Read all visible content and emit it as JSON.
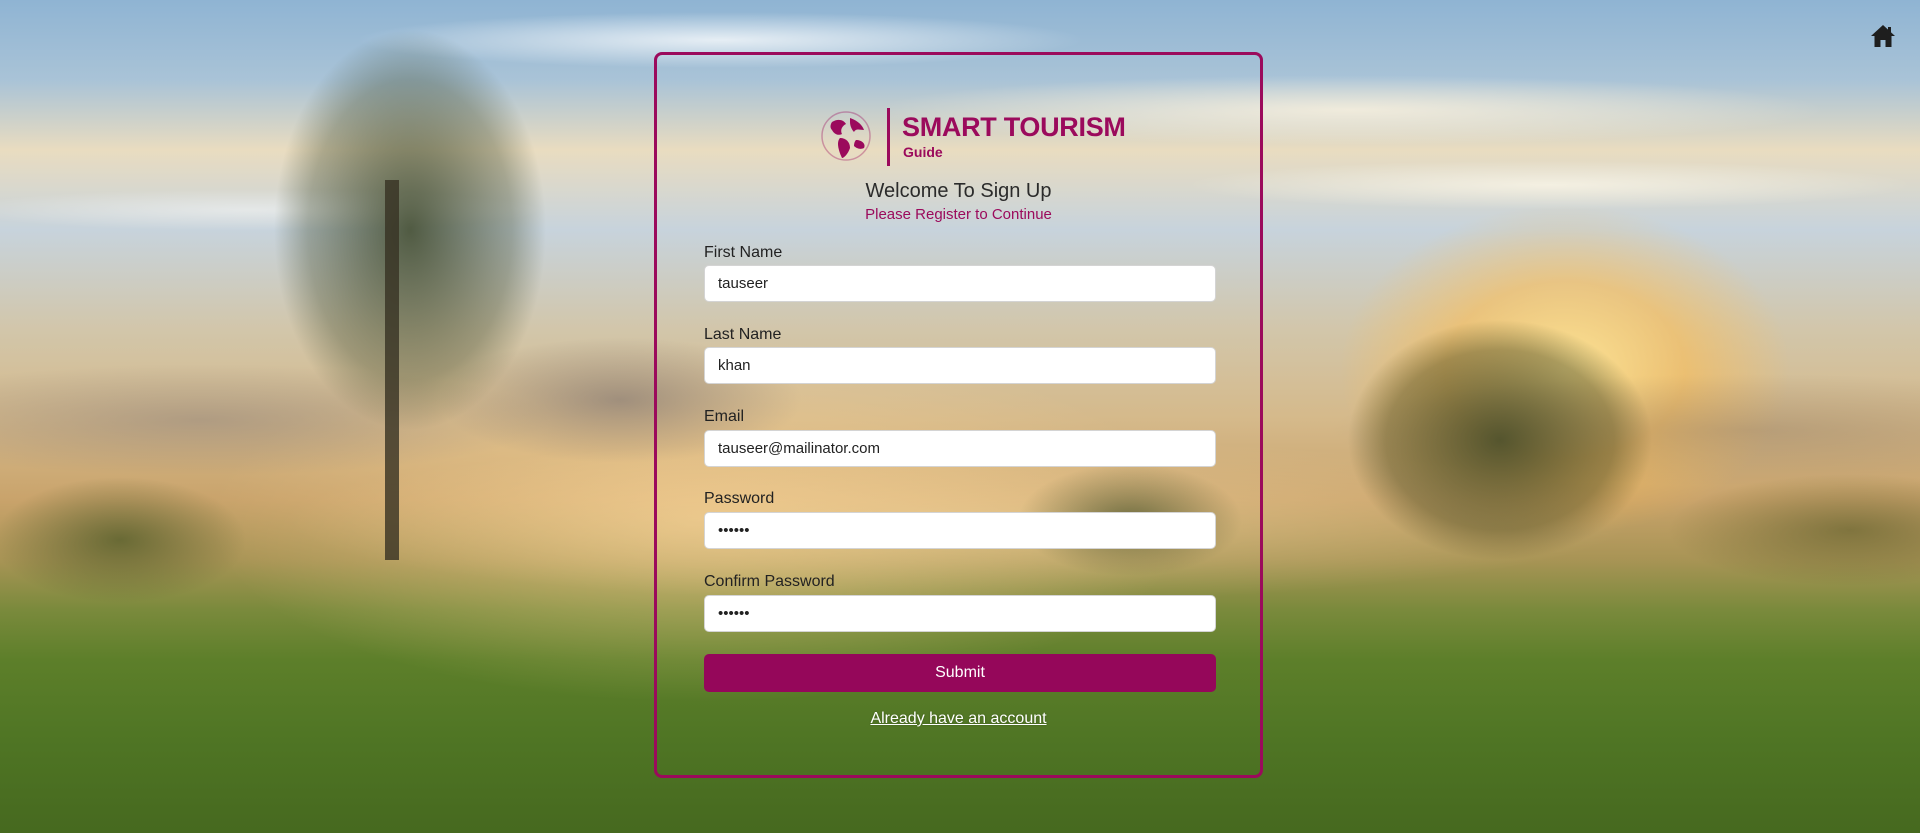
{
  "header": {
    "home_icon": "home-icon"
  },
  "logo": {
    "title": "SMART TOURISM",
    "subtitle": "Guide",
    "icon": "globe-icon",
    "color": "#9b0a5c"
  },
  "form": {
    "heading": "Welcome To Sign Up",
    "subheading": "Please Register to Continue",
    "fields": {
      "first_name": {
        "label": "First Name",
        "value": "tauseer"
      },
      "last_name": {
        "label": "Last Name",
        "value": "khan"
      },
      "email": {
        "label": "Email",
        "value": "tauseer@mailinator.com"
      },
      "password": {
        "label": "Password",
        "value": "••••••"
      },
      "confirm_password": {
        "label": "Confirm Password",
        "value": "••••••"
      }
    },
    "submit_label": "Submit",
    "login_link": "Already have an account"
  },
  "colors": {
    "accent": "#9b0a5c",
    "button": "#95075a"
  }
}
